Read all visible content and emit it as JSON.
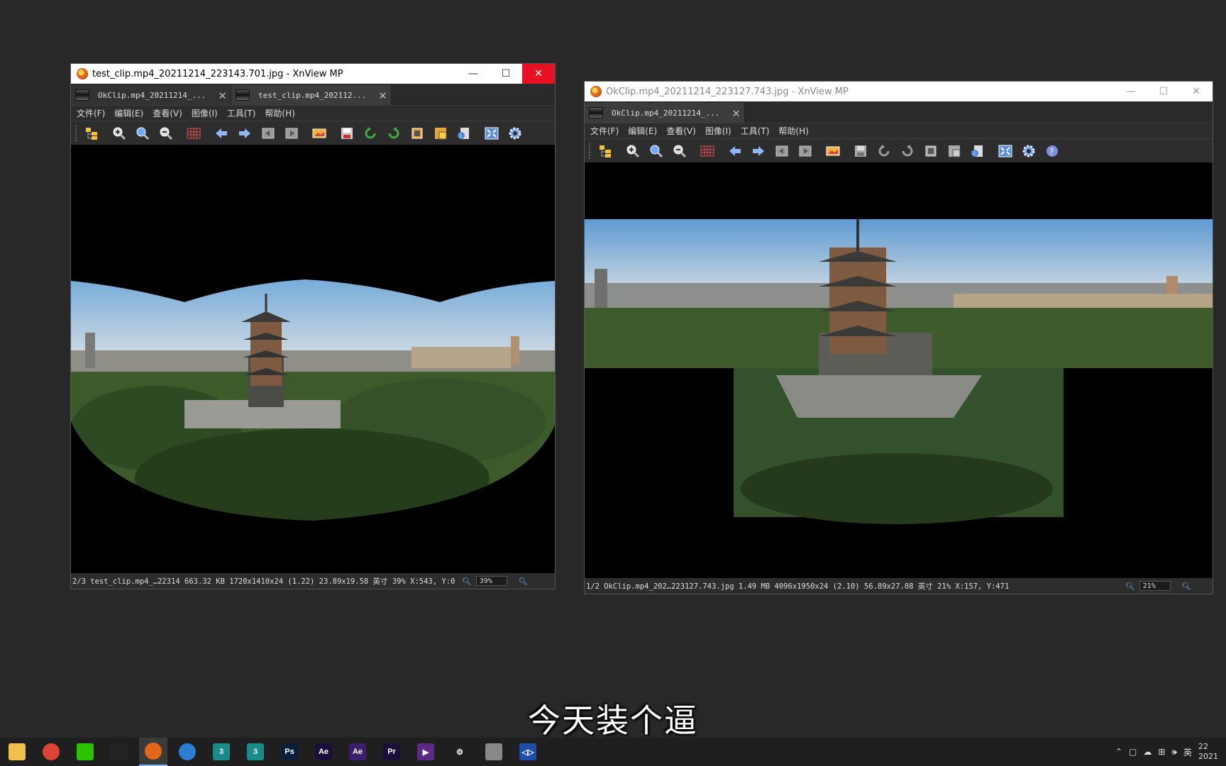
{
  "windows": [
    {
      "title": "test_clip.mp4_20211214_223143.701.jpg - XnView MP",
      "active": true,
      "tabs": [
        {
          "label": "OkClip.mp4_20211214_..."
        },
        {
          "label": "test_clip.mp4_202112..."
        }
      ],
      "menu": [
        "文件(F)",
        "编辑(E)",
        "查看(V)",
        "图像(I)",
        "工具(T)",
        "帮助(H)"
      ],
      "status": {
        "text": "2/3  test_clip.mp4_…22314  663.32 KB  1720x1410x24 (1.22) 23.89x19.58 英寸  39%  X:543, Y:0",
        "zoom": "39%"
      }
    },
    {
      "title": "OkClip.mp4_20211214_223127.743.jpg - XnView MP",
      "active": false,
      "tabs": [
        {
          "label": "OkClip.mp4_20211214_..."
        }
      ],
      "menu": [
        "文件(F)",
        "编辑(E)",
        "查看(V)",
        "图像(I)",
        "工具(T)",
        "帮助(H)"
      ],
      "status": {
        "text": "1/2  OkClip.mp4_202…223127.743.jpg  1.49 MB  4096x1950x24 (2.10) 56.89x27.08 英寸  21%  X:157, Y:471",
        "zoom": "21%"
      }
    }
  ],
  "window_controls": {
    "minimize": "—",
    "maximize": "☐",
    "close": "✕"
  },
  "subtitle": "今天装个逼",
  "taskbar": {
    "apps": [
      {
        "name": "file-explorer",
        "glyph": "",
        "color": "#f2c04a"
      },
      {
        "name": "chrome",
        "glyph": "",
        "color": "#db4437"
      },
      {
        "name": "wechat",
        "glyph": "",
        "color": "#2dc100"
      },
      {
        "name": "qq",
        "glyph": "",
        "color": "#222222"
      },
      {
        "name": "xnview",
        "glyph": "",
        "color": "#e2671b"
      },
      {
        "name": "media-player",
        "glyph": "",
        "color": "#2a7fd4"
      },
      {
        "name": "3dsmax-1",
        "glyph": "3",
        "color": "#1a8a8a"
      },
      {
        "name": "3dsmax-2",
        "glyph": "3",
        "color": "#1a8a8a"
      },
      {
        "name": "photoshop",
        "glyph": "Ps",
        "color": "#0b1f3a"
      },
      {
        "name": "after-effects",
        "glyph": "Ae",
        "color": "#1b0e3a"
      },
      {
        "name": "after-effects-2",
        "glyph": "Ae",
        "color": "#3a1f6a"
      },
      {
        "name": "premiere",
        "glyph": "Pr",
        "color": "#1b0e3a"
      },
      {
        "name": "video-app",
        "glyph": "▶",
        "color": "#5b2a86"
      },
      {
        "name": "settings",
        "glyph": "⚙",
        "color": "#1f1f1f"
      },
      {
        "name": "photos",
        "glyph": "",
        "color": "#888888"
      },
      {
        "name": "video-editor",
        "glyph": "◁▷",
        "color": "#1e4ea8"
      }
    ],
    "tray": {
      "ime": "英",
      "clock_top": "22",
      "clock_bottom": "2021"
    }
  }
}
